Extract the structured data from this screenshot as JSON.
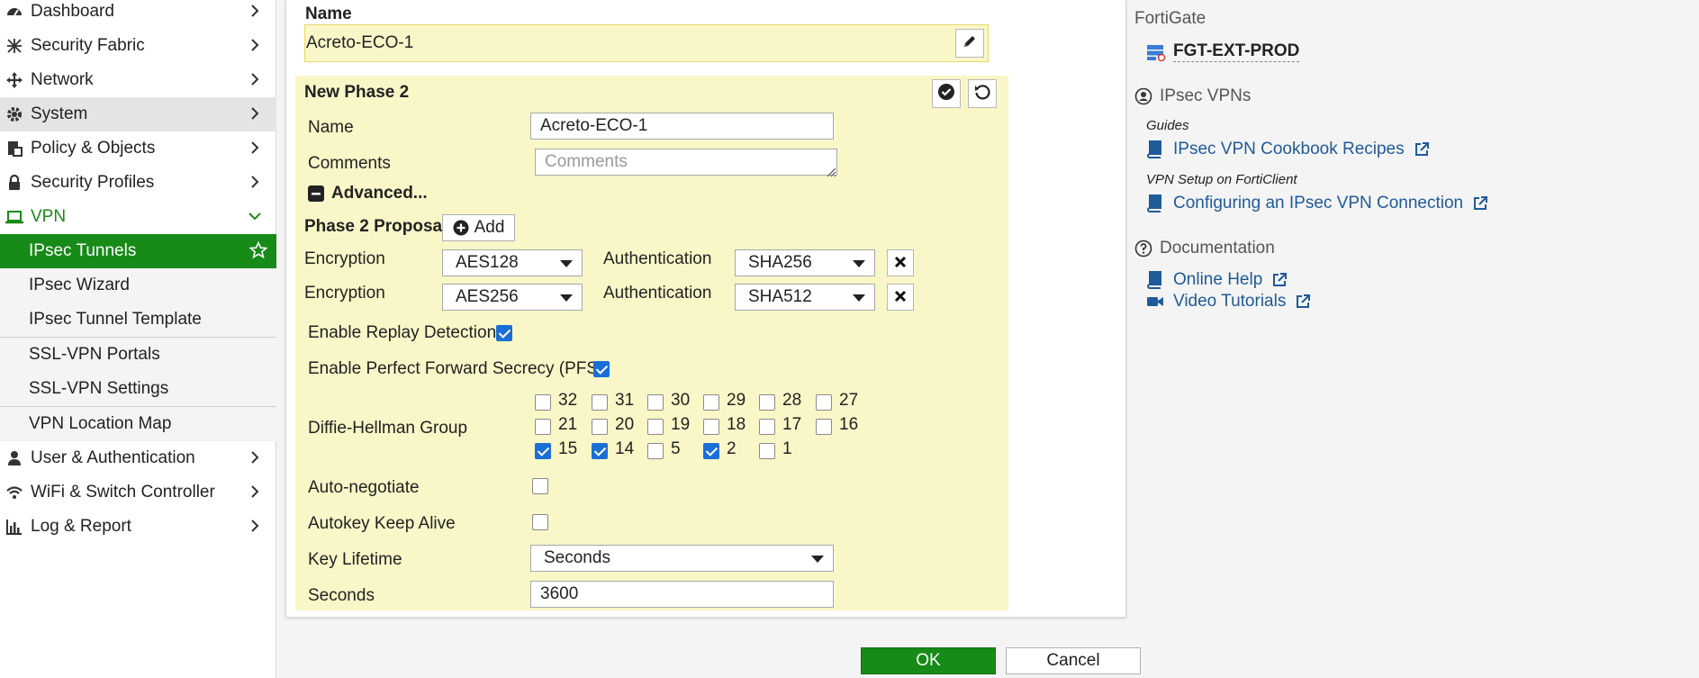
{
  "sidebar": {
    "items": [
      {
        "label": "Dashboard",
        "icon": "dashboard-icon"
      },
      {
        "label": "Security Fabric",
        "icon": "security-fabric-icon"
      },
      {
        "label": "Network",
        "icon": "network-icon"
      },
      {
        "label": "System",
        "icon": "gear-icon"
      },
      {
        "label": "Policy & Objects",
        "icon": "policy-icon"
      },
      {
        "label": "Security Profiles",
        "icon": "lock-icon"
      },
      {
        "label": "VPN",
        "icon": "laptop-icon"
      },
      {
        "label": "User & Authentication",
        "icon": "user-icon"
      },
      {
        "label": "WiFi & Switch Controller",
        "icon": "wifi-icon"
      },
      {
        "label": "Log & Report",
        "icon": "bar-chart-icon"
      }
    ],
    "vpn_sub": [
      {
        "label": "IPsec Tunnels"
      },
      {
        "label": "IPsec Wizard"
      },
      {
        "label": "IPsec Tunnel Template"
      },
      {
        "label": "SSL-VPN Portals"
      },
      {
        "label": "SSL-VPN Settings"
      },
      {
        "label": "VPN Location Map"
      }
    ]
  },
  "form": {
    "name_label": "Name",
    "name_value": "Acreto-ECO-1",
    "phase2_title": "New Phase 2",
    "p2_name_label": "Name",
    "p2_name_value": "Acreto-ECO-1",
    "comments_label": "Comments",
    "comments_placeholder": "Comments",
    "advanced_label": "Advanced...",
    "proposal_label": "Phase 2 Proposal",
    "add_label": "Add",
    "proposals": [
      {
        "enc_label": "Encryption",
        "enc_value": "AES128",
        "auth_label": "Authentication",
        "auth_value": "SHA256"
      },
      {
        "enc_label": "Encryption",
        "enc_value": "AES256",
        "auth_label": "Authentication",
        "auth_value": "SHA512"
      }
    ],
    "replay_label": "Enable Replay Detection",
    "replay_checked": true,
    "pfs_label": "Enable Perfect Forward Secrecy (PFS)",
    "pfs_checked": true,
    "dh_label": "Diffie-Hellman Group",
    "dh_rows": [
      [
        {
          "n": "32",
          "c": false
        },
        {
          "n": "31",
          "c": false
        },
        {
          "n": "30",
          "c": false
        },
        {
          "n": "29",
          "c": false
        },
        {
          "n": "28",
          "c": false
        },
        {
          "n": "27",
          "c": false
        }
      ],
      [
        {
          "n": "21",
          "c": false
        },
        {
          "n": "20",
          "c": false
        },
        {
          "n": "19",
          "c": false
        },
        {
          "n": "18",
          "c": false
        },
        {
          "n": "17",
          "c": false
        },
        {
          "n": "16",
          "c": false
        }
      ],
      [
        {
          "n": "15",
          "c": true
        },
        {
          "n": "14",
          "c": true
        },
        {
          "n": "5",
          "c": false
        },
        {
          "n": "2",
          "c": true
        },
        {
          "n": "1",
          "c": false
        }
      ]
    ],
    "autoneg_label": "Auto-negotiate",
    "autoneg_checked": false,
    "keepalive_label": "Autokey Keep Alive",
    "keepalive_checked": false,
    "key_lifetime_label": "Key Lifetime",
    "key_lifetime_value": "Seconds",
    "seconds_label": "Seconds",
    "seconds_value": "3600"
  },
  "right_panel": {
    "fortigate_label": "FortiGate",
    "device_name": "FGT-EXT-PROD",
    "ipsec_header": "IPsec VPNs",
    "guides_label": "Guides",
    "cookbook_link": "IPsec VPN Cookbook Recipes",
    "forticlient_label": "VPN Setup on FortiClient",
    "configuring_link": "Configuring an IPsec VPN Connection",
    "documentation_header": "Documentation",
    "online_help_link": "Online Help",
    "video_tutorials_link": "Video Tutorials"
  },
  "footer": {
    "ok_label": "OK",
    "cancel_label": "Cancel"
  },
  "colors": {
    "accent_green": "#178a17",
    "highlight_yellow": "#f9f7c8",
    "link_blue": "#1f5a99",
    "checkbox_blue": "#1a6fd6"
  }
}
